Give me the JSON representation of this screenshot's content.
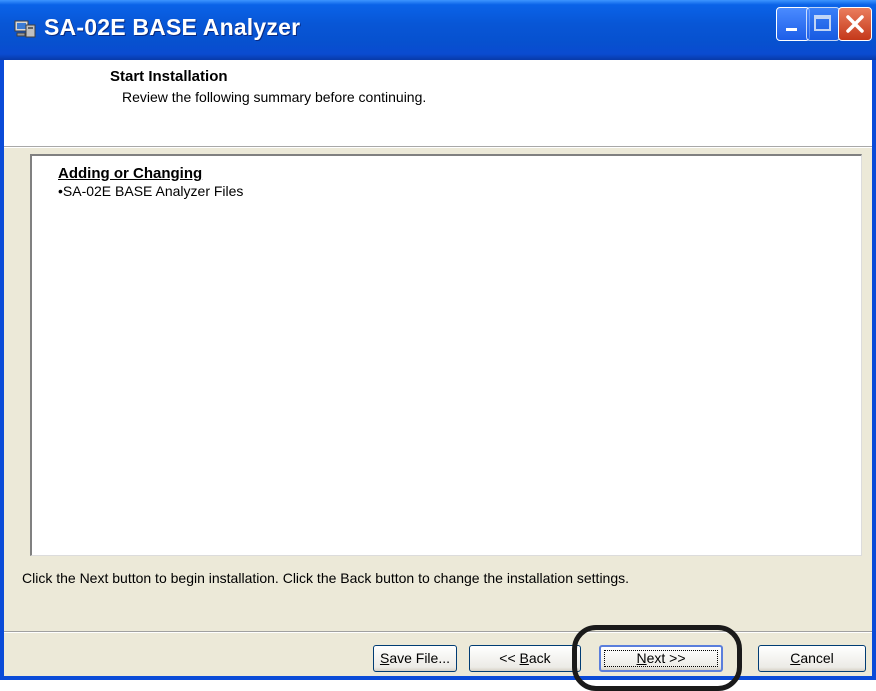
{
  "window": {
    "title": "SA-02E BASE Analyzer",
    "app_icon": "installer-computer-icon",
    "controls": {
      "minimize_icon": "minimize-icon",
      "maximize_icon": "maximize-icon",
      "close_icon": "close-icon"
    }
  },
  "header": {
    "title": "Start Installation",
    "subtitle": "Review the following summary before continuing."
  },
  "summary": {
    "heading": "Adding or Changing",
    "items": [
      "•SA-02E BASE Analyzer Files"
    ]
  },
  "info_text": "Click the Next button to begin installation.  Click the Back button to change the installation settings.",
  "buttons": {
    "save": {
      "label": "Save File...",
      "access_key": "S",
      "rest": "ave File..."
    },
    "back": {
      "label": "<< Back",
      "pre": "<< ",
      "access_key": "B",
      "rest": "ack"
    },
    "next": {
      "label": "Next >>",
      "access_key": "N",
      "rest": "ext >>"
    },
    "cancel": {
      "label": "Cancel",
      "access_key": "C",
      "rest": "ancel"
    }
  },
  "colors": {
    "titlebar": "#0a4bd8",
    "dialog_background": "#ece9d8",
    "close_button": "#c4381a",
    "highlight_ring": "#1a1a1a"
  }
}
